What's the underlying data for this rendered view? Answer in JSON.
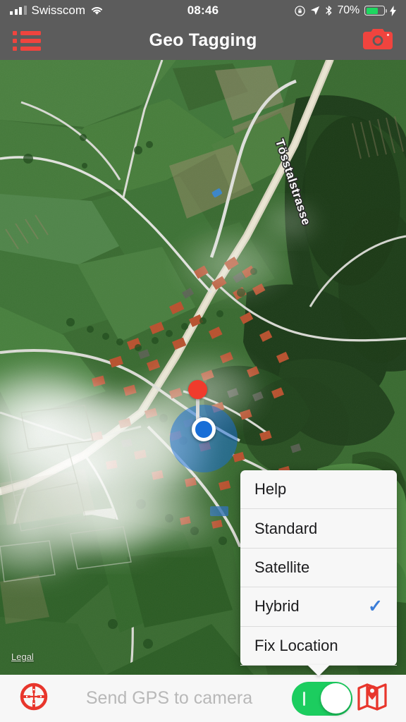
{
  "status_bar": {
    "carrier": "Swisscom",
    "time": "08:46",
    "battery_percent": "70%",
    "battery_level": 70,
    "icons": [
      "signal-bars-icon",
      "wifi-icon",
      "rotation-lock-icon",
      "location-arrow-icon",
      "bluetooth-icon",
      "battery-icon",
      "charging-bolt-icon"
    ]
  },
  "nav_bar": {
    "title": "Geo Tagging",
    "left_icon": "list-menu-icon",
    "right_icon": "camera-icon",
    "accent_color": "#f0443e",
    "background_color": "#5c5c5c"
  },
  "map": {
    "type": "Hybrid",
    "street_label": "Tösstalstrasse",
    "legal_link": "Legal",
    "marker": "red-pin-marker",
    "user_location": "blue-location-dot",
    "accuracy_circle_color": "#186ed7"
  },
  "popup_menu": {
    "items": [
      {
        "label": "Help",
        "checked": false
      },
      {
        "label": "Standard",
        "checked": false
      },
      {
        "label": "Satellite",
        "checked": false
      },
      {
        "label": "Hybrid",
        "checked": true
      },
      {
        "label": "Fix Location",
        "checked": false
      }
    ],
    "check_glyph": "✓",
    "check_color": "#3b7dd8"
  },
  "bottom_bar": {
    "crosshair_icon": "crosshair-target-icon",
    "label": "Send GPS to camera",
    "toggle_state": "on",
    "toggle_on_color": "#1ccd5f",
    "map_icon": "map-pin-icon",
    "accent_color": "#e8362c"
  }
}
